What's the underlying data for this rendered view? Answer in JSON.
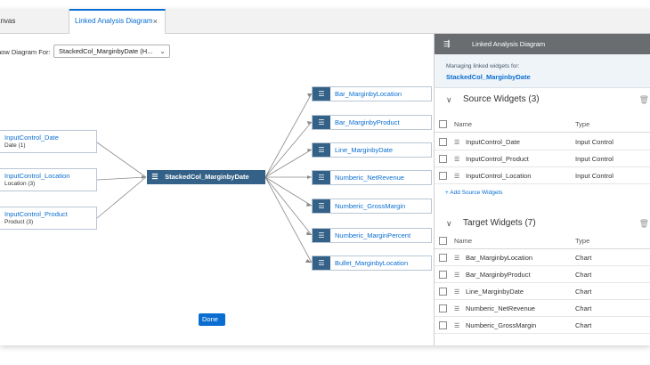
{
  "tabs": [
    {
      "label": "anvas"
    },
    {
      "label": "Linked Analysis Diagram",
      "close": "×"
    }
  ],
  "diagram": {
    "show_for_label": "how Diagram For:",
    "selected": "StackedCol_MarginbyDate (H...",
    "center_node": "StackedCol_MarginbyDate",
    "sources": [
      {
        "title": "InputControl_Date",
        "sub": "Date (1)"
      },
      {
        "title": "InputControl_Location",
        "sub": "Location (3)"
      },
      {
        "title": "InputControl_Product",
        "sub": "Product (3)"
      }
    ],
    "targets": [
      "Bar_MarginbyLocation",
      "Bar_MarginbyProduct",
      "Line_MarginbyDate",
      "Numberic_NetRevenue",
      "Numberic_GrossMargin",
      "Numberic_MarginPercent",
      "Bullet_MarginbyLocation"
    ]
  },
  "panel": {
    "title": "Linked Analysis Diagram",
    "managing_label": "Managing linked widgets for:",
    "managing_name": "StackedCol_MarginbyDate",
    "source_section": {
      "title": "Source Widgets (3)"
    },
    "target_section": {
      "title": "Target Widgets (7)"
    },
    "col_name": "Name",
    "col_type": "Type",
    "source_rows": [
      {
        "name": "InputControl_Date",
        "type": "Input Control"
      },
      {
        "name": "InputControl_Product",
        "type": "Input Control"
      },
      {
        "name": "InputControl_Location",
        "type": "Input Control"
      }
    ],
    "add_source": "+ Add Source Widgets",
    "target_rows": [
      {
        "name": "Bar_MarginbyLocation",
        "type": "Chart"
      },
      {
        "name": "Bar_MarginbyProduct",
        "type": "Chart"
      },
      {
        "name": "Line_MarginbyDate",
        "type": "Chart"
      },
      {
        "name": "Numberic_NetRevenue",
        "type": "Chart"
      },
      {
        "name": "Numberic_GrossMargin",
        "type": "Chart"
      }
    ],
    "done_label": "Done"
  }
}
